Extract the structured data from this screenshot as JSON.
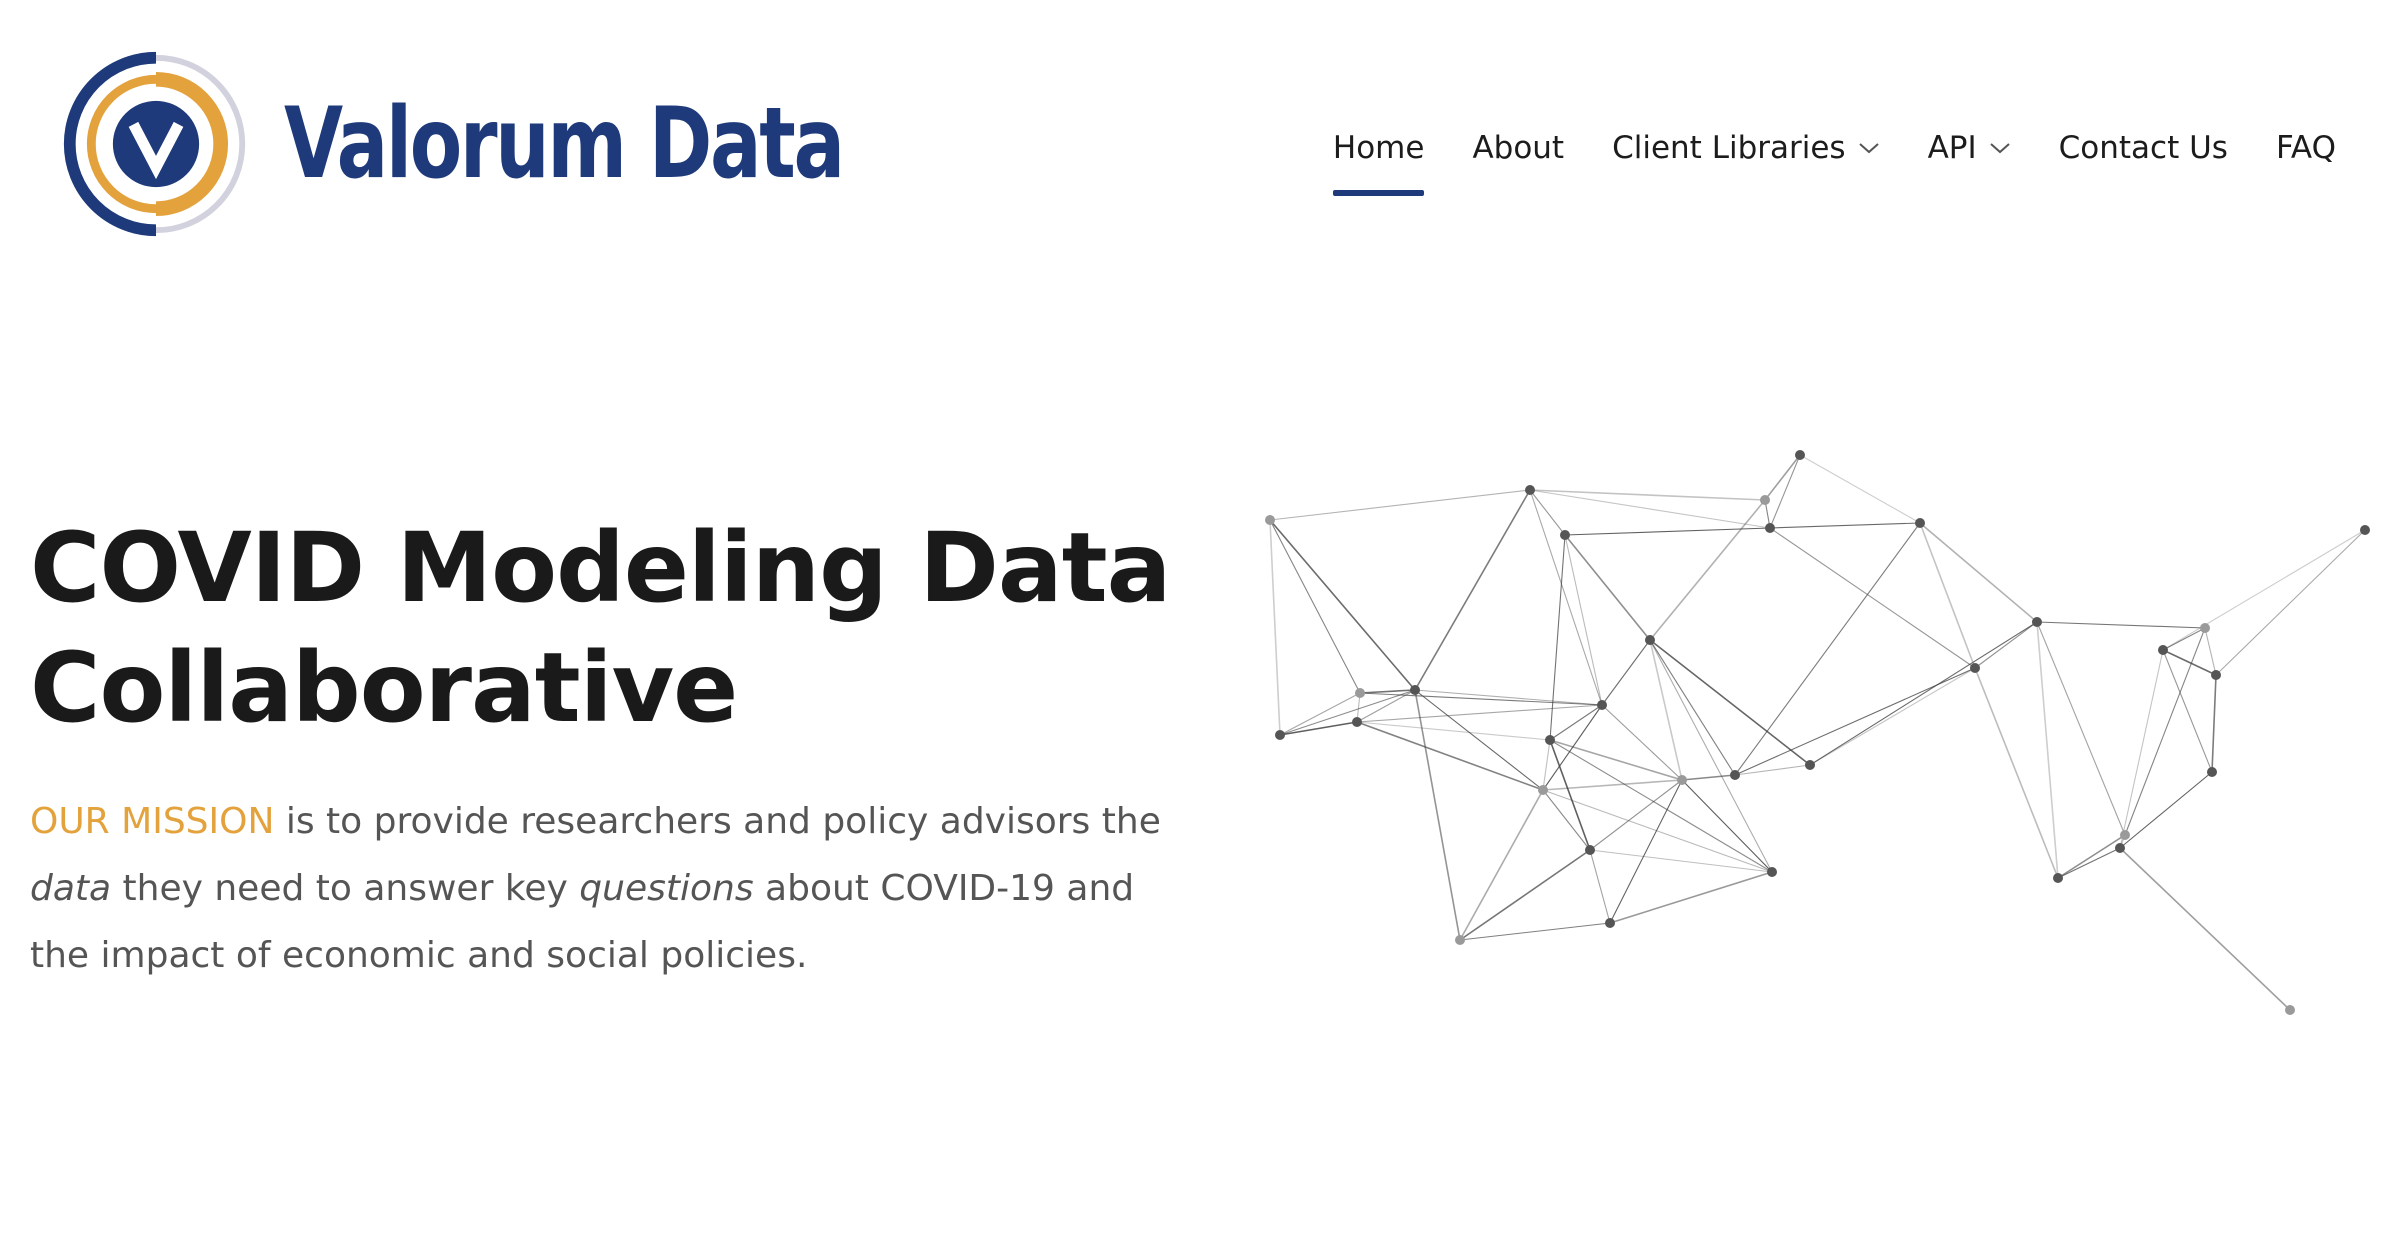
{
  "brand": {
    "name": "Valorum Data",
    "colors": {
      "navy": "#1e3a7b",
      "gold": "#e3a23c",
      "grey": "#c9c9d6"
    }
  },
  "nav": {
    "home": "Home",
    "about": "About",
    "client_libraries": "Client Libraries",
    "api": "API",
    "contact": "Contact Us",
    "faq": "FAQ",
    "active": "Home"
  },
  "hero": {
    "title_line1": "COVID Modeling Data",
    "title_line2": "Collaborative",
    "mission_lead": "OUR MISSION",
    "mission_part1": " is to provide researchers and policy advisors the ",
    "mission_em1": "data",
    "mission_part2": " they need to answer key ",
    "mission_em2": "questions",
    "mission_part3": " about COVID-19 and the impact of economic and social policies."
  },
  "illustration": {
    "name": "network-map-illustration"
  }
}
